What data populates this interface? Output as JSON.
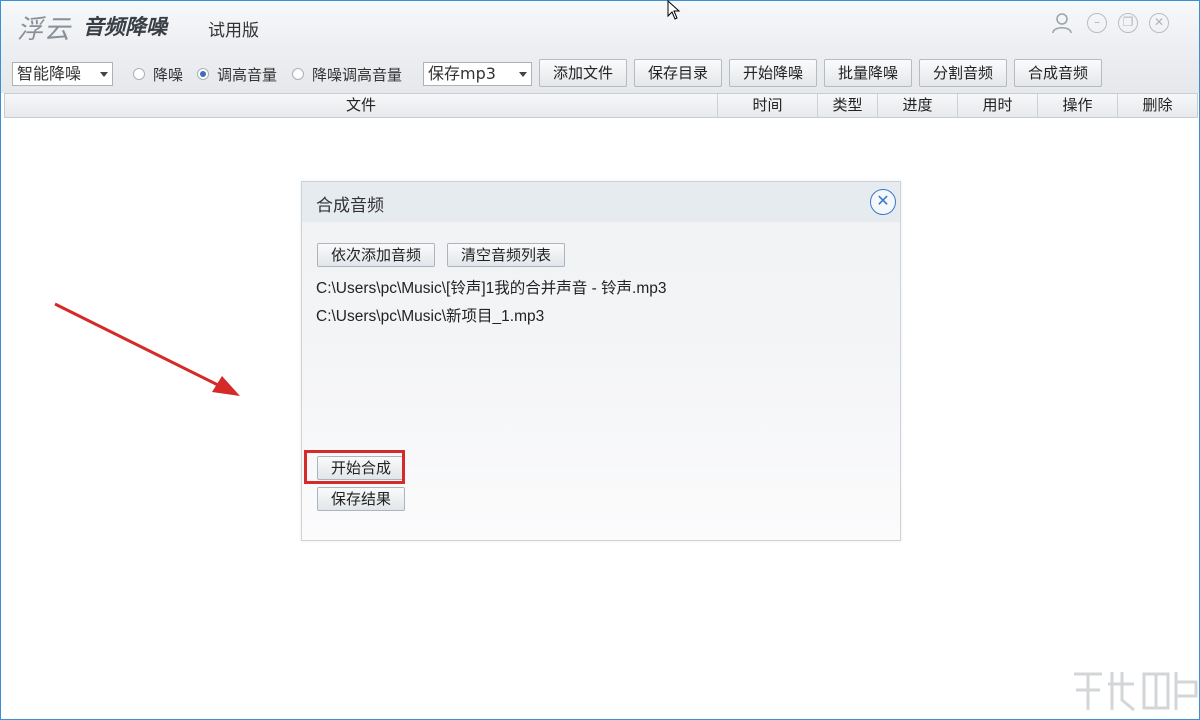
{
  "app": {
    "logo_text": "浮云",
    "name": "音频降噪",
    "edition": "试用版"
  },
  "window_controls": {
    "user": "user-icon",
    "minimize": "–",
    "restore": "❐",
    "close": "✕"
  },
  "toolbar": {
    "mode_select": "智能降噪",
    "radios": [
      {
        "label": "降噪",
        "selected": false
      },
      {
        "label": "调高音量",
        "selected": true
      },
      {
        "label": "降噪调高音量",
        "selected": false
      }
    ],
    "format_select": "保存mp3",
    "buttons": [
      "添加文件",
      "保存目录",
      "开始降噪",
      "批量降噪",
      "分割音频",
      "合成音频"
    ]
  },
  "table": {
    "columns": [
      "文件",
      "时间",
      "类型",
      "进度",
      "用时",
      "操作",
      "删除"
    ],
    "rows": []
  },
  "dialog": {
    "title": "合成音频",
    "close_icon": "close-icon",
    "add_button": "依次添加音频",
    "clear_button": "清空音频列表",
    "files": [
      "C:\\Users\\pc\\Music\\[铃声]1我的合并声音 - 铃声.mp3",
      "C:\\Users\\pc\\Music\\新项目_1.mp3"
    ],
    "start_button": "开始合成",
    "save_button": "保存结果"
  },
  "colors": {
    "accent": "#3a79c8",
    "annotation_red": "#d52a2a",
    "window_border": "#3b8fd8"
  }
}
